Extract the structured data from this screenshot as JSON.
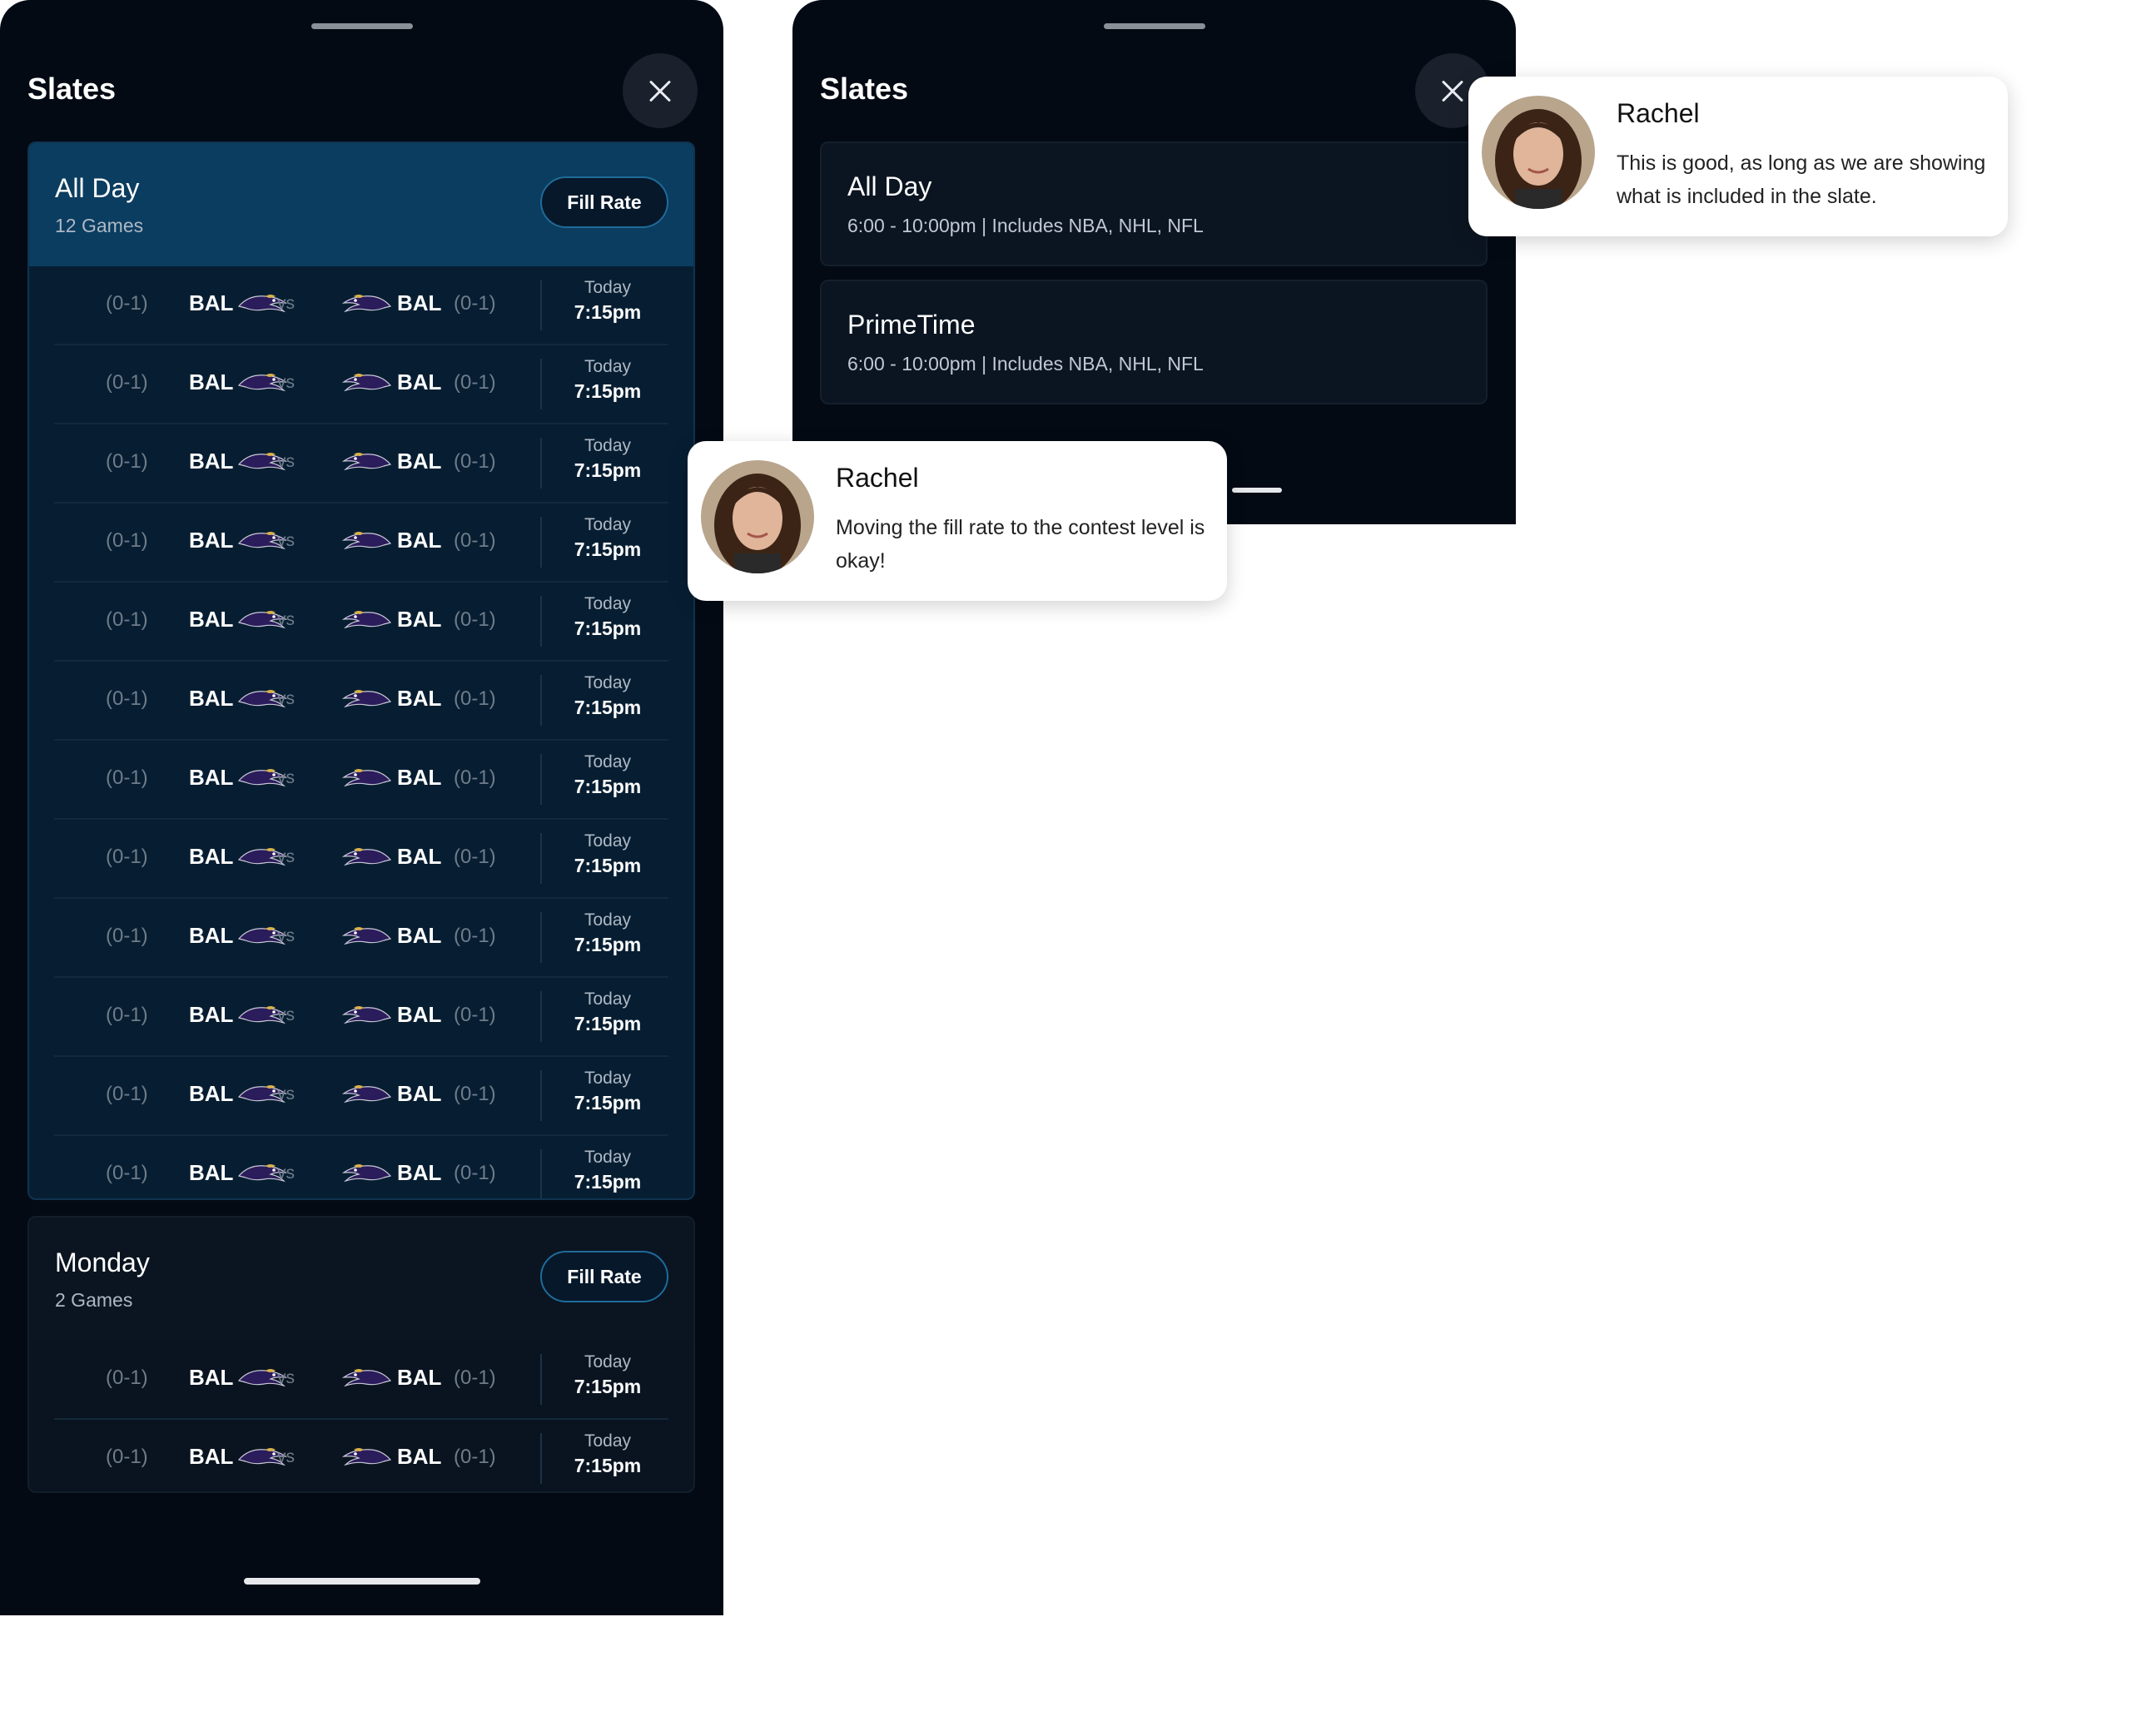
{
  "left_panel": {
    "title": "Slates",
    "slates": [
      {
        "name": "All Day",
        "count": "12 Games",
        "fill_rate": "Fill Rate",
        "games": [
          {
            "away_record": "(0-1)",
            "away": "BAL",
            "vs": "vs",
            "home": "BAL",
            "home_record": "(0-1)",
            "day": "Today",
            "time": "7:15pm"
          },
          {
            "away_record": "(0-1)",
            "away": "BAL",
            "vs": "vs",
            "home": "BAL",
            "home_record": "(0-1)",
            "day": "Today",
            "time": "7:15pm"
          },
          {
            "away_record": "(0-1)",
            "away": "BAL",
            "vs": "vs",
            "home": "BAL",
            "home_record": "(0-1)",
            "day": "Today",
            "time": "7:15pm"
          },
          {
            "away_record": "(0-1)",
            "away": "BAL",
            "vs": "vs",
            "home": "BAL",
            "home_record": "(0-1)",
            "day": "Today",
            "time": "7:15pm"
          },
          {
            "away_record": "(0-1)",
            "away": "BAL",
            "vs": "vs",
            "home": "BAL",
            "home_record": "(0-1)",
            "day": "Today",
            "time": "7:15pm"
          },
          {
            "away_record": "(0-1)",
            "away": "BAL",
            "vs": "vs",
            "home": "BAL",
            "home_record": "(0-1)",
            "day": "Today",
            "time": "7:15pm"
          },
          {
            "away_record": "(0-1)",
            "away": "BAL",
            "vs": "vs",
            "home": "BAL",
            "home_record": "(0-1)",
            "day": "Today",
            "time": "7:15pm"
          },
          {
            "away_record": "(0-1)",
            "away": "BAL",
            "vs": "vs",
            "home": "BAL",
            "home_record": "(0-1)",
            "day": "Today",
            "time": "7:15pm"
          },
          {
            "away_record": "(0-1)",
            "away": "BAL",
            "vs": "vs",
            "home": "BAL",
            "home_record": "(0-1)",
            "day": "Today",
            "time": "7:15pm"
          },
          {
            "away_record": "(0-1)",
            "away": "BAL",
            "vs": "vs",
            "home": "BAL",
            "home_record": "(0-1)",
            "day": "Today",
            "time": "7:15pm"
          },
          {
            "away_record": "(0-1)",
            "away": "BAL",
            "vs": "vs",
            "home": "BAL",
            "home_record": "(0-1)",
            "day": "Today",
            "time": "7:15pm"
          },
          {
            "away_record": "(0-1)",
            "away": "BAL",
            "vs": "vs",
            "home": "BAL",
            "home_record": "(0-1)",
            "day": "Today",
            "time": "7:15pm"
          }
        ]
      },
      {
        "name": "Monday",
        "count": "2 Games",
        "fill_rate": "Fill Rate",
        "games": [
          {
            "away_record": "(0-1)",
            "away": "BAL",
            "vs": "vs",
            "home": "BAL",
            "home_record": "(0-1)",
            "day": "Today",
            "time": "7:15pm"
          },
          {
            "away_record": "(0-1)",
            "away": "BAL",
            "vs": "vs",
            "home": "BAL",
            "home_record": "(0-1)",
            "day": "Today",
            "time": "7:15pm"
          }
        ]
      }
    ]
  },
  "right_panel": {
    "title": "Slates",
    "slates": [
      {
        "name": "All Day",
        "description": "6:00 - 10:00pm | Includes NBA, NHL, NFL"
      },
      {
        "name": "PrimeTime",
        "description": "6:00 - 10:00pm | Includes NBA, NHL, NFL"
      }
    ]
  },
  "comments": [
    {
      "author": "Rachel",
      "text": "This is good, as long as we are showing what is included in the slate."
    },
    {
      "author": "Rachel",
      "text": "Moving the fill rate to the contest level is okay!"
    }
  ],
  "icons": {
    "team_logo": "raven-head-icon",
    "close": "close-icon",
    "avatar": "avatar-photo"
  },
  "colors": {
    "panel_bg": "#030a14",
    "selected_slate_header": "#0b3d60",
    "fill_rate_border": "#1f6b9a",
    "logo_purple": "#2b1c5c"
  }
}
